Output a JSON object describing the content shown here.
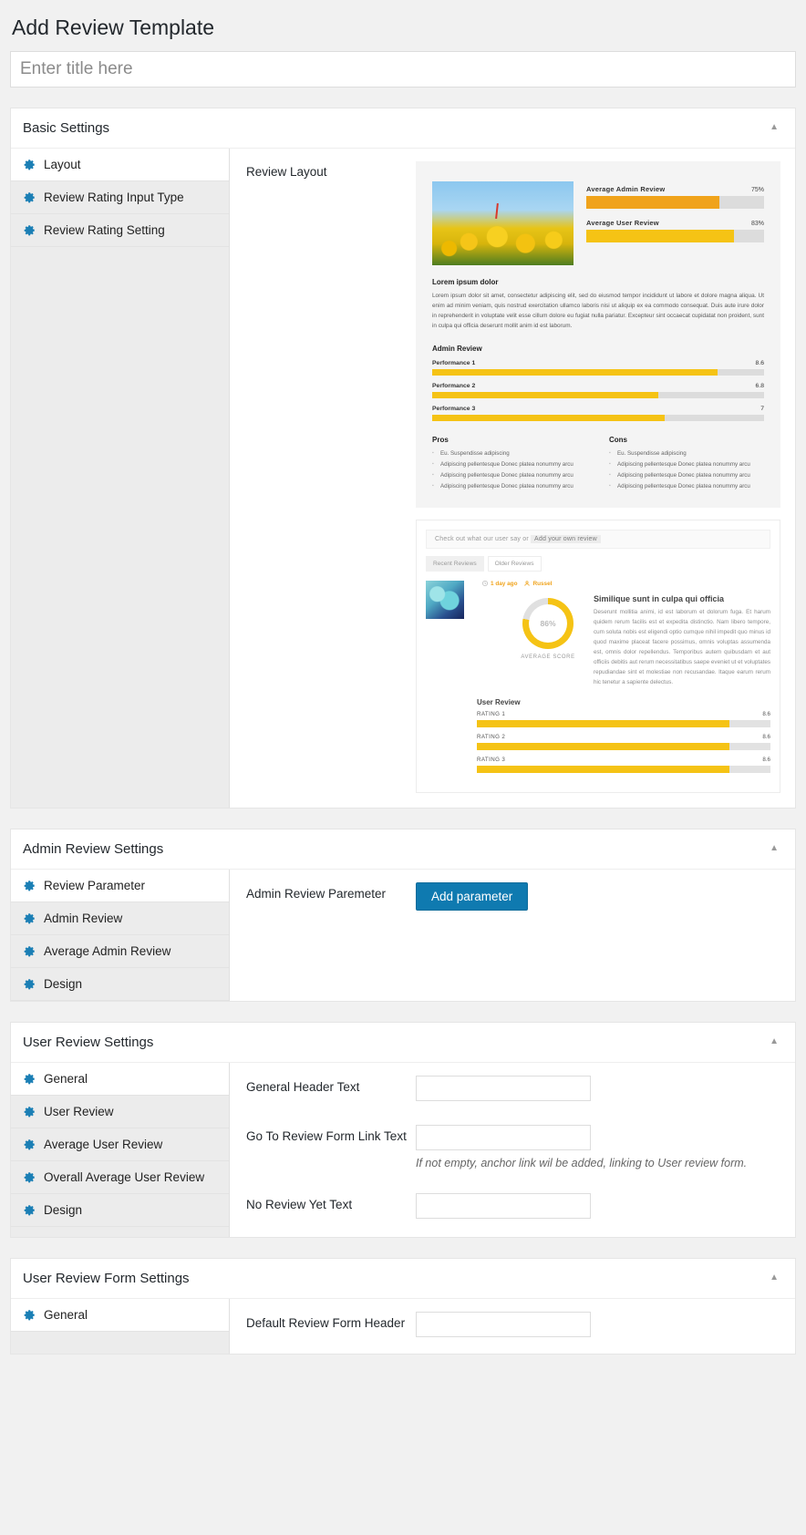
{
  "page": {
    "title": "Add Review Template",
    "title_placeholder": "Enter title here"
  },
  "icons": {
    "gear": "gear-icon",
    "collapse": "▲"
  },
  "basic_settings": {
    "title": "Basic Settings",
    "tabs": [
      {
        "label": "Layout",
        "active": true
      },
      {
        "label": "Review Rating Input Type",
        "active": false
      },
      {
        "label": "Review Rating Setting",
        "active": false
      }
    ],
    "field_label": "Review Layout"
  },
  "preview": {
    "average": [
      {
        "name": "Average Admin Review",
        "pct": "75%",
        "value": 75,
        "color": "#f0a31b"
      },
      {
        "name": "Average User Review",
        "pct": "83%",
        "value": 83,
        "color": "#f5c315"
      }
    ],
    "heading": "Lorem ipsum dolor",
    "paragraph": "Lorem ipsum dolor sit amet, consectetur adipiscing elit, sed do eiusmod tempor incididunt ut labore et dolore magna aliqua. Ut enim ad minim veniam, quis nostrud exercitation ullamco laboris nisi ut aliquip ex ea commodo consequat. Duis aute irure dolor in reprehenderit in voluptate velit esse cillum dolore eu fugiat nulla pariatur. Excepteur sint occaecat cupidatat non proident, sunt in culpa qui officia deserunt mollit anim id est laborum.",
    "admin_review_title": "Admin Review",
    "performance": [
      {
        "name": "Performance 1",
        "value": "8.6",
        "pct": 86
      },
      {
        "name": "Performance 2",
        "value": "6.8",
        "pct": 68
      },
      {
        "name": "Performance 3",
        "value": "7",
        "pct": 70
      }
    ],
    "pros_title": "Pros",
    "cons_title": "Cons",
    "pros": [
      "Eu. Suspendisse adipiscing",
      "Adipiscing pellentesque Donec platea nonummy arcu",
      "Adipiscing pellentesque Donec platea nonummy arcu",
      "Adipiscing pellentesque Donec platea nonummy arcu"
    ],
    "cons": [
      "Eu. Suspendisse adipiscing",
      "Adipiscing pellentesque Donec platea nonummy arcu",
      "Adipiscing pellentesque Donec platea nonummy arcu",
      "Adipiscing pellentesque Donec platea nonummy arcu"
    ],
    "cta_text": "Check out what our user say or",
    "cta_link": "Add your own review",
    "review_tabs": [
      {
        "label": "Recent Reviews"
      },
      {
        "label": "Older Reviews"
      }
    ],
    "review_time": "1 day ago",
    "review_author": "Russel",
    "score_value": "86%",
    "score_caption": "AVERAGE SCORE",
    "review_title": "Similique sunt in culpa qui officia",
    "review_desc": "Deserunt mollitia animi, id est laborum et dolorum fuga. Et harum quidem rerum facilis est et expedita distinctio. Nam libero tempore, cum soluta nobis est eligendi optio cumque nihil impedit quo minus id quod maxime placeat facere possimus, omnis voluptas assumenda est, omnis dolor repellendus. Temporibus autem quibusdam et aut officiis debitis aut rerum necessitatibus saepe eveniet ut et voluptates repudiandae sint et molestiae non recusandae. Itaque earum rerum hic tenetur a sapiente delectus.",
    "user_review_title": "User Review",
    "user_ratings": [
      {
        "name": "RATING 1",
        "value": "8.6",
        "pct": 86
      },
      {
        "name": "RATING 2",
        "value": "8.6",
        "pct": 86
      },
      {
        "name": "RATING 3",
        "value": "8.6",
        "pct": 86
      }
    ]
  },
  "admin_review_settings": {
    "title": "Admin Review Settings",
    "tabs": [
      {
        "label": "Review Parameter",
        "active": true
      },
      {
        "label": "Admin Review",
        "active": false
      },
      {
        "label": "Average Admin Review",
        "active": false
      },
      {
        "label": "Design",
        "active": false
      }
    ],
    "field_label": "Admin Review Paremeter",
    "button_label": "Add parameter"
  },
  "user_review_settings": {
    "title": "User Review Settings",
    "tabs": [
      {
        "label": "General",
        "active": true
      },
      {
        "label": "User Review",
        "active": false
      },
      {
        "label": "Average User Review",
        "active": false
      },
      {
        "label": "Overall Average User Review",
        "active": false
      },
      {
        "label": "Design",
        "active": false
      }
    ],
    "fields": [
      {
        "label": "General Header Text",
        "value": ""
      },
      {
        "label": "Go To Review Form Link Text",
        "value": "",
        "help": "If not empty, anchor link wil be added, linking to User review form."
      },
      {
        "label": "No Review Yet Text",
        "value": ""
      }
    ]
  },
  "user_review_form_settings": {
    "title": "User Review Form Settings",
    "tabs": [
      {
        "label": "General",
        "active": true
      }
    ],
    "field_label": "Default Review Form Header"
  }
}
